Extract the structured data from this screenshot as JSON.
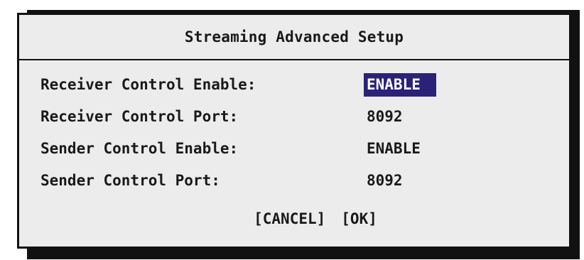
{
  "dialog": {
    "title": "Streaming Advanced Setup",
    "settings": [
      {
        "label": "Receiver Control Enable:",
        "value": "ENABLE",
        "selected": true
      },
      {
        "label": "Receiver Control Port:",
        "value": "8092",
        "selected": false
      },
      {
        "label": "Sender Control Enable:",
        "value": "ENABLE",
        "selected": false
      },
      {
        "label": "Sender Control Port:",
        "value": "8092",
        "selected": false
      }
    ],
    "buttons": {
      "cancel": "[CANCEL]",
      "ok": "[OK]"
    }
  },
  "colors": {
    "background": "#ececec",
    "border": "#111111",
    "highlight": "#2b2278",
    "highlight_text": "#ffffff"
  }
}
